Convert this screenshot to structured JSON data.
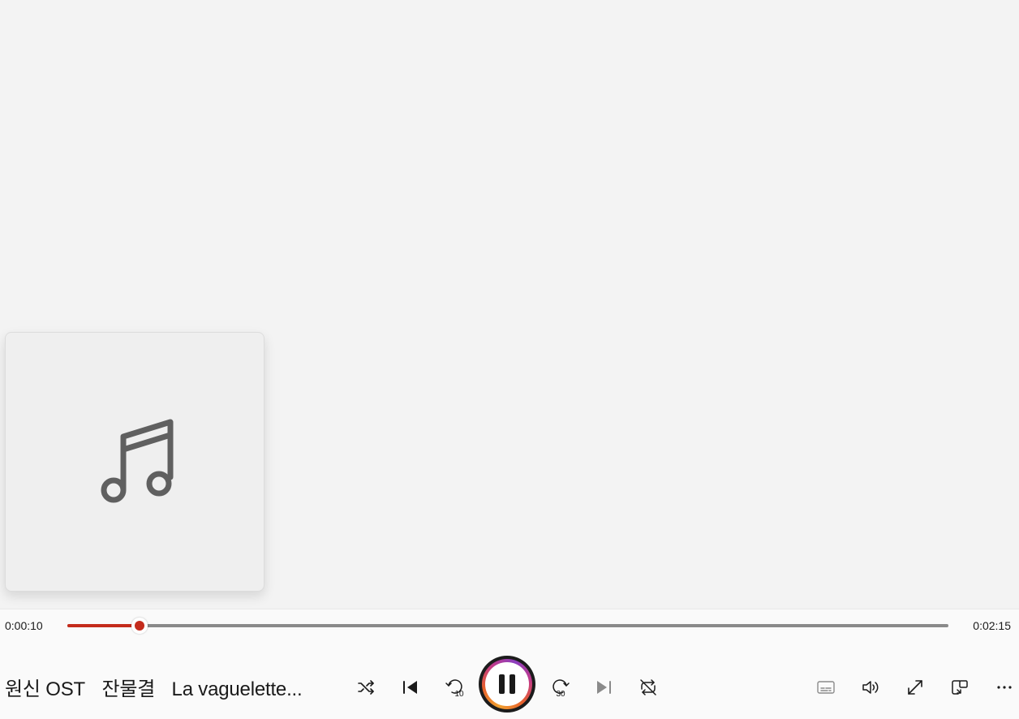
{
  "player": {
    "elapsed": "0:00:10",
    "duration": "0:02:15",
    "progress_fraction": 0.082,
    "accent_color": "#c42b1c"
  },
  "now_playing": {
    "album": "원신 OST",
    "artist": "잔물결",
    "title": "La vaguelette..."
  },
  "album_art": {
    "icon": "music-note-icon"
  },
  "controls": {
    "shuffle": "shuffle-icon",
    "previous": "previous-icon",
    "skip_back": "skip-back-10-icon",
    "skip_back_label": "10",
    "play_pause": "pause-icon",
    "skip_forward": "skip-forward-30-icon",
    "skip_forward_label": "30",
    "next": "next-icon",
    "repeat": "repeat-icon",
    "captions": "captions-icon",
    "volume": "volume-icon",
    "fullscreen": "fullscreen-icon",
    "miniplayer": "miniplayer-icon",
    "more": "more-icon"
  }
}
